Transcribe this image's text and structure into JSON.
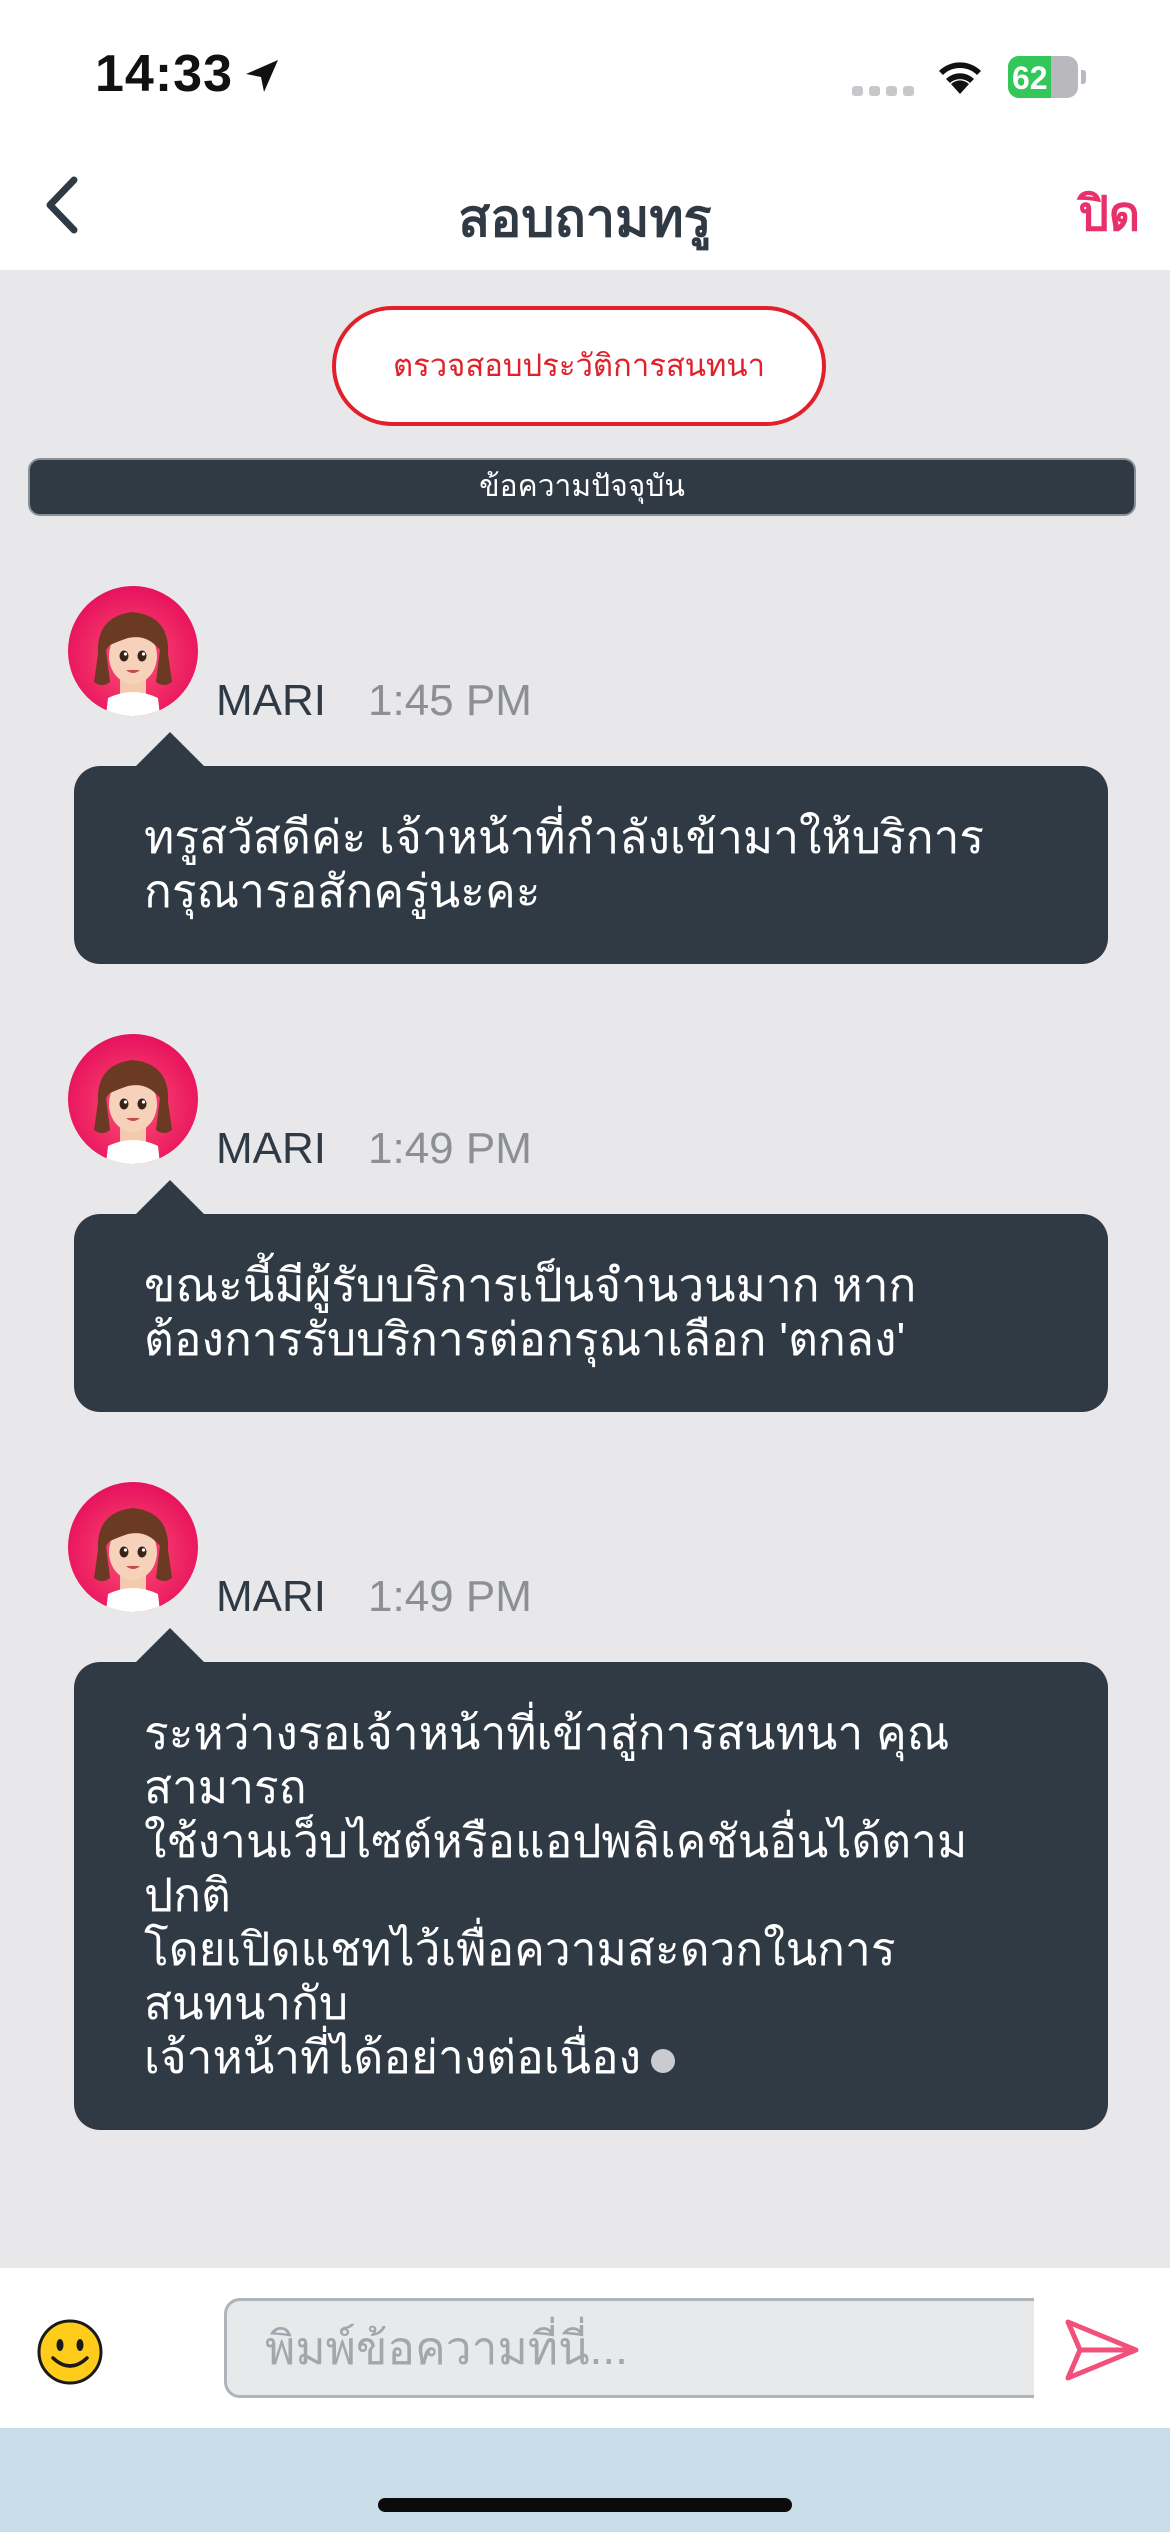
{
  "status_bar": {
    "time": "14:33",
    "battery_level": "62",
    "battery_fraction": 0.62,
    "battery_color": "#33c759",
    "icons": [
      "location-arrow-icon",
      "cellular-signal-icon",
      "wifi-icon",
      "battery-charging-icon"
    ]
  },
  "nav": {
    "title": "สอบถามทรู",
    "close_label": "ปิด",
    "accent_color": "#e8306a"
  },
  "history_button": {
    "label": "ตรวจสอบประวัติการสนทนา",
    "color": "#e0202a"
  },
  "current_bar": {
    "label": "ข้อความปัจจุบัน"
  },
  "messages": [
    {
      "sender": "MARI",
      "time": "1:45 PM",
      "lines": [
        "ทรูสวัสดีค่ะ เจ้าหน้าที่กำลังเข้ามาให้บริการ",
        "กรุณารอสักครู่นะคะ"
      ]
    },
    {
      "sender": "MARI",
      "time": "1:49 PM",
      "lines": [
        "ขณะนี้มีผู้รับบริการเป็นจำนวนมาก หาก",
        "ต้องการรับบริการต่อกรุณาเลือก 'ตกลง'"
      ]
    },
    {
      "sender": "MARI",
      "time": "1:49 PM",
      "lines": [
        "ระหว่างรอเจ้าหน้าที่เข้าสู่การสนทนา คุณสามารถ",
        "ใช้งานเว็บไซต์หรือแอปพลิเคชันอื่นได้ตามปกติ",
        "โดยเปิดแชทไว้เพื่อความสะดวกในการสนทนากับ",
        "เจ้าหน้าที่ได้อย่างต่อเนื่อง"
      ]
    }
  ],
  "composer": {
    "placeholder": "พิมพ์ข้อความที่นี่...",
    "value": "",
    "emoji_icon": "smiley-emoji-icon",
    "send_icon": "send-arrow-icon",
    "send_color": "#f0507a"
  },
  "colors": {
    "bubble": "#2f3a44",
    "background": "#e8e8ea"
  }
}
